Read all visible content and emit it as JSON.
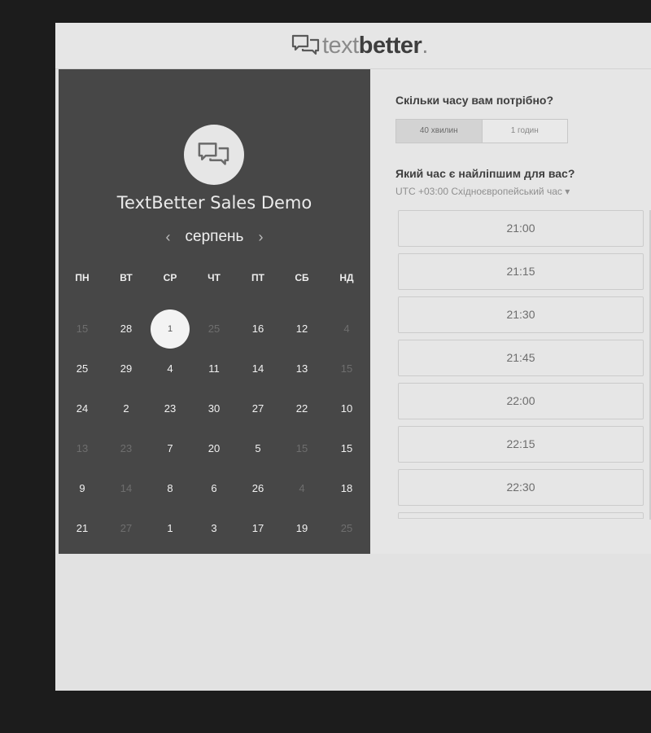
{
  "header": {
    "logo_icon": "chat-bubbles-icon",
    "logo_text_light": "text",
    "logo_text_bold": "better",
    "logo_dot": "."
  },
  "left": {
    "avatar_icon": "chat-bubbles-icon",
    "event_title": "TextBetter Sales Demo",
    "prev_label": "‹",
    "month": "серпень",
    "next_label": "›",
    "weekdays": [
      "ПН",
      "ВТ",
      "СР",
      "ЧТ",
      "ПТ",
      "СБ",
      "НД"
    ],
    "days": [
      [
        "15",
        "28",
        "1",
        "25",
        "16",
        "12",
        "4"
      ],
      [
        "25",
        "29",
        "4",
        "11",
        "14",
        "13",
        "15"
      ],
      [
        "24",
        "2",
        "23",
        "30",
        "27",
        "22",
        "10"
      ],
      [
        "13",
        "23",
        "7",
        "20",
        "5",
        "15",
        "15"
      ],
      [
        "9",
        "14",
        "8",
        "6",
        "26",
        "4",
        "18"
      ],
      [
        "21",
        "27",
        "1",
        "3",
        "17",
        "19",
        "25"
      ]
    ]
  },
  "right": {
    "duration_question": "Скільки часу вам потрібно?",
    "durations": [
      "40 хвилин",
      "1 годин"
    ],
    "time_question": "Який час є найліпшим для вас?",
    "timezone": "UTC +03:00 Східноєвропейський час ▾",
    "slots": [
      "21:00",
      "21:15",
      "21:30",
      "21:45",
      "22:00",
      "22:15",
      "22:30"
    ]
  }
}
